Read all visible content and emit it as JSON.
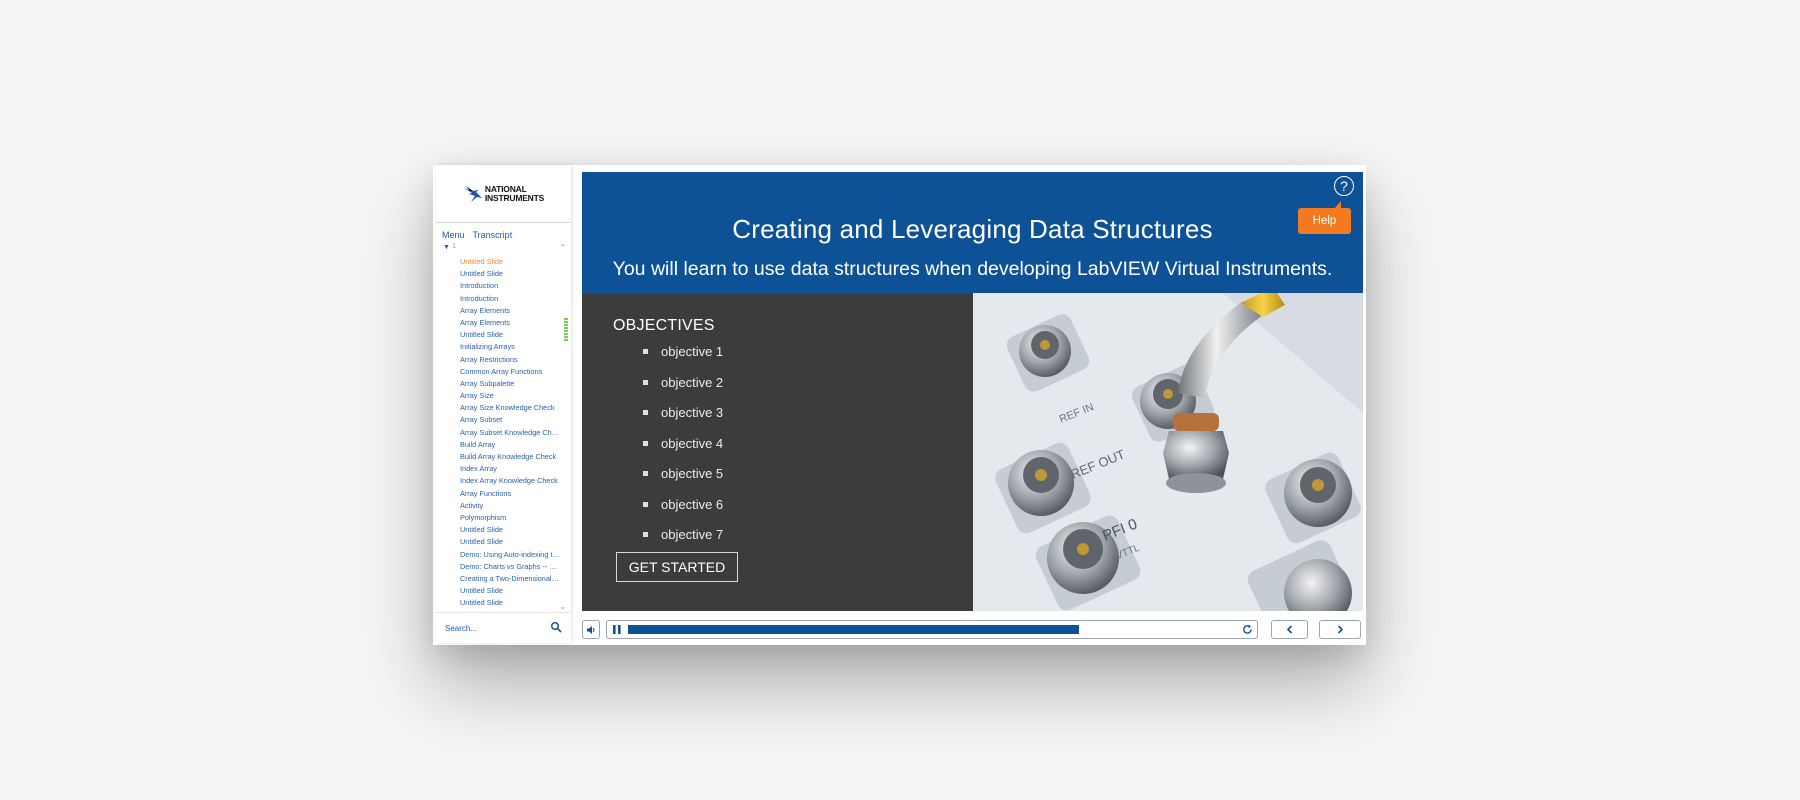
{
  "sidebar": {
    "logo_line1": "NATIONAL",
    "logo_line2": "INSTRUMENTS",
    "tabs": [
      "Menu",
      "Transcript"
    ],
    "tree_number": "1",
    "items": [
      "Untitled Slide",
      "Untitled Slide",
      "Introduction",
      "Introduction",
      "Array Elements",
      "Array Elements",
      "Untitled Slide",
      "Initializing Arrays",
      "Array Restrictions",
      "Common Array Functions",
      "Array Subpalette",
      "Array Size",
      "Array Size Knowledge Check",
      "Array Subset",
      "Array Subset Knowledge Check",
      "Build Array",
      "Build Array Knowledge Check",
      "Index Array",
      "Index Array Knowledge Check",
      "Array Functions",
      "Activity",
      "Polymorphism",
      "Untitled Slide",
      "Untitled Slide",
      "Demo: Using Auto-indexing to Create a...",
      "Demo: Charts vs Graphs -- Single and...",
      "Creating a Two-Dimensional Array",
      "Untitled Slide",
      "Untitled Slide"
    ],
    "active_index": 0,
    "search_placeholder": "Search..."
  },
  "slide": {
    "title": "Creating and Leveraging Data Structures",
    "subtitle": "You will learn to use data structures when developing LabVIEW Virtual Instruments.",
    "help_icon_glyph": "?",
    "help_label": "Help",
    "objectives_heading": "OBJECTIVES",
    "objectives": [
      "objective 1",
      "objective 2",
      "objective 3",
      "objective 4",
      "objective 5",
      "objective 6",
      "objective 7"
    ],
    "get_started_label": "GET STARTED",
    "photo_labels": [
      "REF IN",
      "REF OUT",
      "PFI 0",
      "LVTTL"
    ]
  },
  "colors": {
    "header_blue": "#0d5196",
    "help_orange": "#f47a20",
    "active_item": "#f28a26",
    "link_blue": "#2a62aa"
  },
  "player": {
    "progress_fraction": 0.74
  }
}
